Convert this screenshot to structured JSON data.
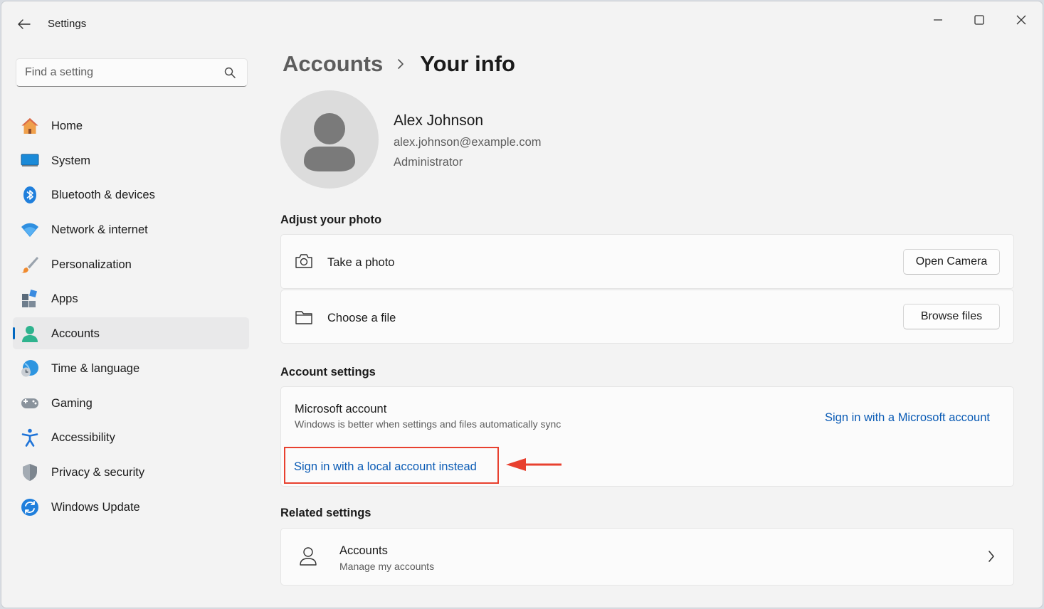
{
  "window": {
    "title": "Settings"
  },
  "search": {
    "placeholder": "Find a setting"
  },
  "sidebar": {
    "items": [
      {
        "label": "Home",
        "icon": "home-icon"
      },
      {
        "label": "System",
        "icon": "system-icon"
      },
      {
        "label": "Bluetooth & devices",
        "icon": "bluetooth-icon"
      },
      {
        "label": "Network & internet",
        "icon": "wifi-icon"
      },
      {
        "label": "Personalization",
        "icon": "brush-icon"
      },
      {
        "label": "Apps",
        "icon": "apps-icon"
      },
      {
        "label": "Accounts",
        "icon": "accounts-icon",
        "selected": true
      },
      {
        "label": "Time & language",
        "icon": "globe-clock-icon"
      },
      {
        "label": "Gaming",
        "icon": "gamepad-icon"
      },
      {
        "label": "Accessibility",
        "icon": "accessibility-icon"
      },
      {
        "label": "Privacy & security",
        "icon": "shield-icon"
      },
      {
        "label": "Windows Update",
        "icon": "update-icon"
      }
    ]
  },
  "breadcrumb": {
    "parent": "Accounts",
    "current": "Your info"
  },
  "user": {
    "name": "Alex Johnson",
    "email": "alex.johnson@example.com",
    "role": "Administrator"
  },
  "photo": {
    "section_title": "Adjust your photo",
    "take_photo": {
      "label": "Take a photo",
      "button": "Open Camera",
      "icon": "camera-icon"
    },
    "choose_file": {
      "label": "Choose a file",
      "button": "Browse files",
      "icon": "folder-icon"
    }
  },
  "account_settings": {
    "section_title": "Account settings",
    "ms_title": "Microsoft account",
    "ms_desc": "Windows is better when settings and files automatically sync",
    "ms_link": "Sign in with a Microsoft account",
    "local_link": "Sign in with a local account instead"
  },
  "related": {
    "section_title": "Related settings",
    "title": "Accounts",
    "subtitle": "Manage my accounts"
  },
  "colors": {
    "accent": "#0067c0",
    "link": "#0a5bb5",
    "highlight": "#e8402f"
  }
}
